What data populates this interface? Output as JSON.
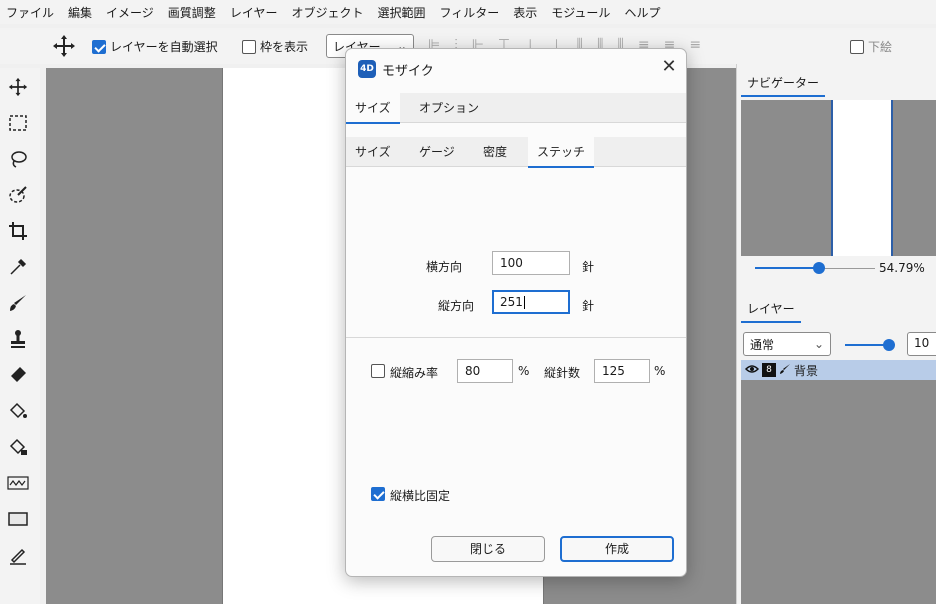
{
  "menu": [
    "ファイル",
    "編集",
    "イメージ",
    "画質調整",
    "レイヤー",
    "オブジェクト",
    "選択範囲",
    "フィルター",
    "表示",
    "モジュール",
    "ヘルプ"
  ],
  "toolbar": {
    "auto_select_label": "レイヤーを自動選択",
    "auto_select_checked": true,
    "show_frame_label": "枠を表示",
    "show_frame_checked": false,
    "target_select": "レイヤー",
    "underlay_label": "下絵",
    "underlay_checked": false
  },
  "tools": [
    "move-icon",
    "marquee-icon",
    "lasso-icon",
    "magic-wand-icon",
    "crop-icon",
    "eyedropper-icon",
    "brush-icon",
    "stamp-icon",
    "eraser-icon",
    "paint-bucket-icon",
    "gradient-bucket-icon",
    "wave-icon",
    "rectangle-icon",
    "pen-icon"
  ],
  "navigator": {
    "tab_label": "ナビゲーター",
    "zoom": "54.79%"
  },
  "layers": {
    "tab_label": "レイヤー",
    "blend_mode": "通常",
    "opacity": "10",
    "rows": [
      {
        "name": "背景",
        "badge": "8"
      }
    ]
  },
  "dialog": {
    "app_icon_text": "4D",
    "title": "モザイク",
    "main_tabs": [
      {
        "label": "サイズ",
        "selected": true
      },
      {
        "label": "オプション",
        "selected": false
      }
    ],
    "sub_tabs": [
      {
        "label": "サイズ",
        "selected": false
      },
      {
        "label": "ゲージ",
        "selected": false
      },
      {
        "label": "密度",
        "selected": false
      },
      {
        "label": "ステッチ",
        "selected": true
      }
    ],
    "horizontal_label": "横方向",
    "horizontal_value": "100",
    "horizontal_unit": "針",
    "vertical_label": "縦方向",
    "vertical_value": "251",
    "vertical_unit": "針",
    "shrink_label": "縦縮み率",
    "shrink_checked": false,
    "shrink_value": "80",
    "shrink_unit": "%",
    "vstitch_label": "縦針数",
    "vstitch_value": "125",
    "vstitch_unit": "%",
    "aspect_label": "縦横比固定",
    "aspect_checked": true,
    "close_button": "閉じる",
    "create_button": "作成"
  }
}
